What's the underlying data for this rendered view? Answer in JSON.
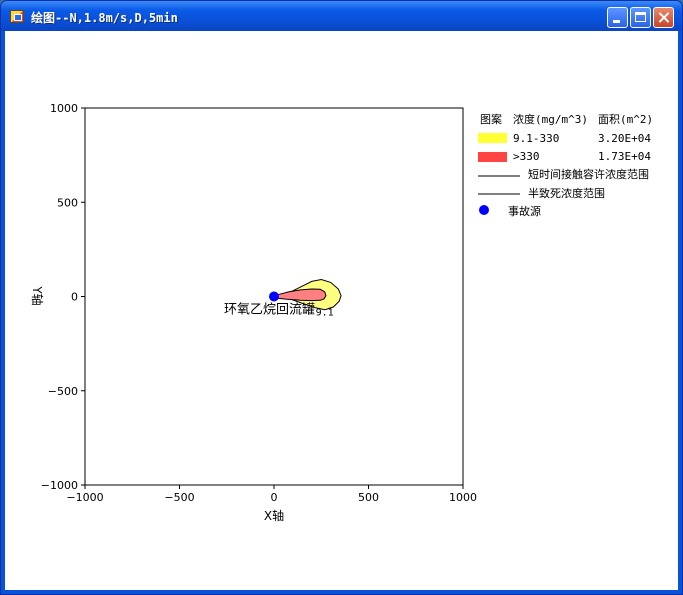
{
  "window": {
    "title": "绘图--N,1.8m/s,D,5min"
  },
  "chart_data": {
    "type": "contour",
    "xlabel": "X轴",
    "ylabel": "Y轴",
    "xlim": [
      -1000,
      1000
    ],
    "ylim": [
      -1000,
      1000
    ],
    "xticks": [
      -1000,
      -500,
      0,
      500,
      1000
    ],
    "yticks": [
      1000,
      500,
      0,
      -500,
      -1000
    ],
    "xtick_labels": [
      "−1000",
      "−500",
      "0",
      "500",
      "1000"
    ],
    "ytick_labels": [
      "1000",
      "500",
      "0",
      "−500",
      "−1000"
    ],
    "grid": false,
    "legend_position": "right",
    "source": {
      "label": "环氧乙烷回流罐",
      "x": 0,
      "y": 0,
      "color": "#0000ff"
    },
    "contour_label": "9.1",
    "zones": [
      {
        "range": "9.1-330",
        "area": "3.20E+04",
        "color": "#ffff80",
        "legend_color": "#ffff33",
        "outline": [
          [
            5,
            -5
          ],
          [
            90,
            -15
          ],
          [
            160,
            -40
          ],
          [
            220,
            -60
          ],
          [
            270,
            -70
          ],
          [
            315,
            -55
          ],
          [
            345,
            -25
          ],
          [
            355,
            5
          ],
          [
            340,
            40
          ],
          [
            300,
            75
          ],
          [
            250,
            90
          ],
          [
            200,
            80
          ],
          [
            150,
            55
          ],
          [
            100,
            30
          ],
          [
            50,
            10
          ],
          [
            5,
            5
          ]
        ]
      },
      {
        "range": ">330",
        "area": "1.73E+04",
        "color": "#ff8080",
        "legend_color": "#ff4444",
        "outline": [
          [
            5,
            -8
          ],
          [
            70,
            -15
          ],
          [
            140,
            -20
          ],
          [
            200,
            -22
          ],
          [
            245,
            -20
          ],
          [
            265,
            -12
          ],
          [
            275,
            5
          ],
          [
            268,
            25
          ],
          [
            245,
            38
          ],
          [
            200,
            40
          ],
          [
            140,
            35
          ],
          [
            80,
            25
          ],
          [
            30,
            12
          ],
          [
            5,
            6
          ]
        ]
      }
    ],
    "legend": {
      "headers": [
        "图案",
        "浓度(mg/m^3)",
        "面积(m^2)"
      ],
      "line_items": [
        "短时间接触容许浓度范围",
        "半致死浓度范围"
      ],
      "source_label": "事故源"
    }
  }
}
